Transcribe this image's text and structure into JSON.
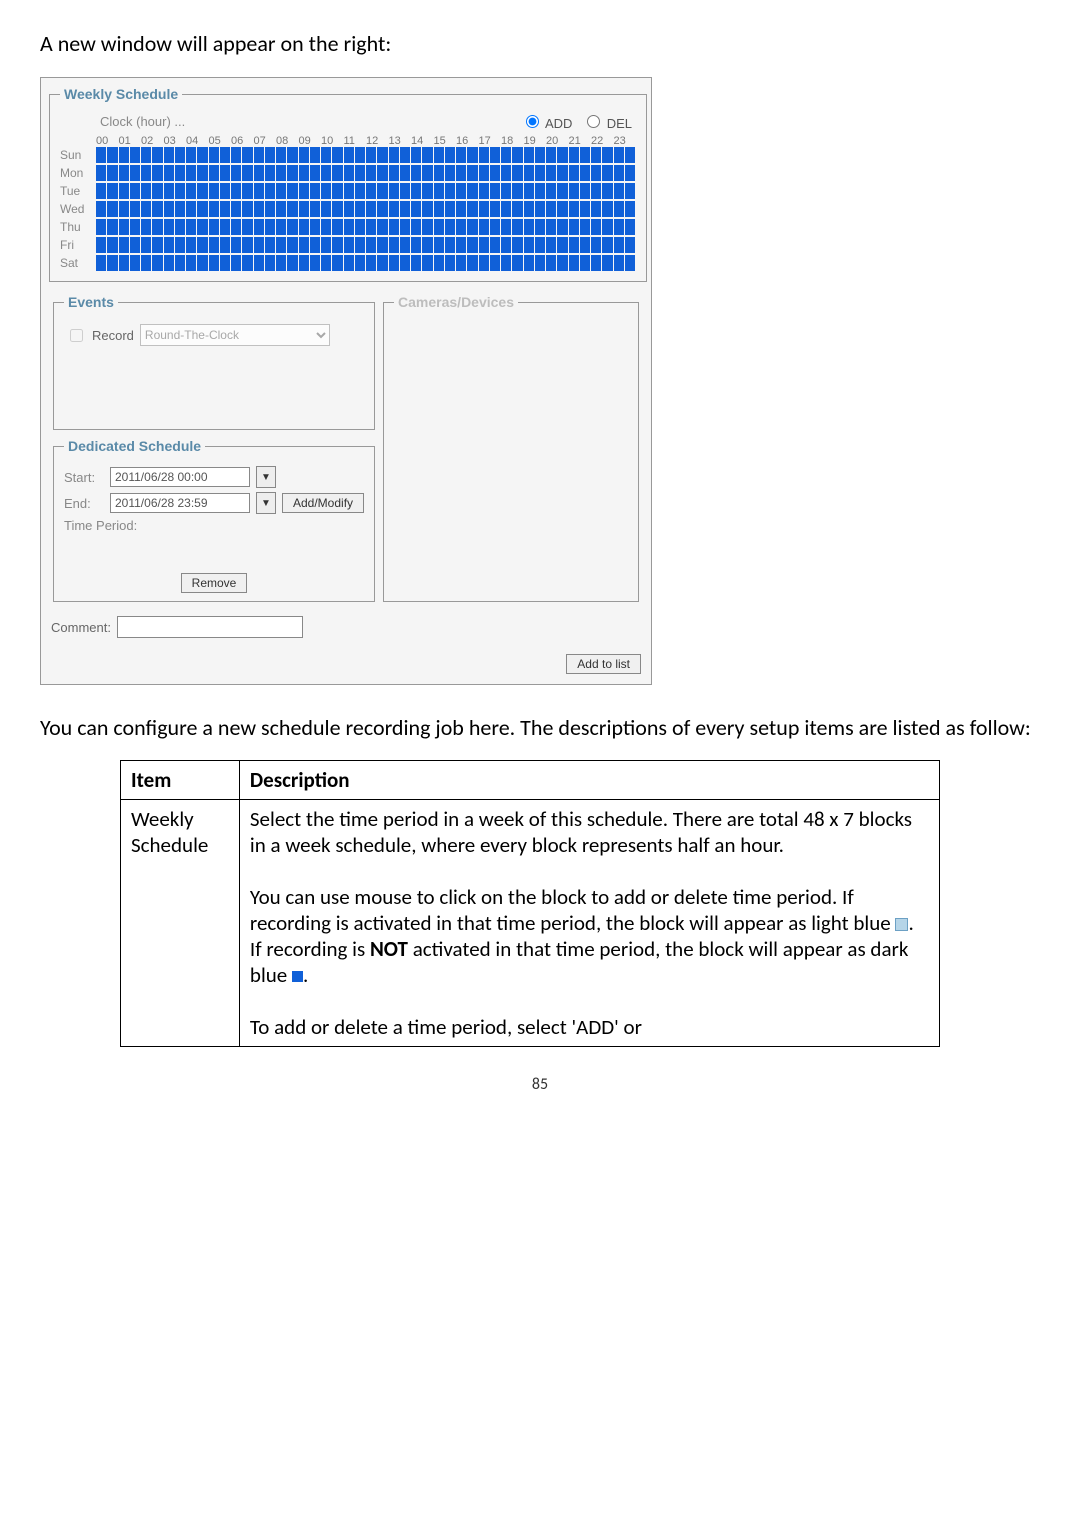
{
  "doc": {
    "intro": "A new window will appear on the right:",
    "para": "You can configure a new schedule recording job here. The descriptions of every setup items are listed as follow:",
    "page_number": "85"
  },
  "win": {
    "weekly_legend": "Weekly Schedule",
    "clock_label": "Clock (hour) ...",
    "add_label": "ADD",
    "del_label": "DEL",
    "hours": [
      "00",
      "01",
      "02",
      "03",
      "04",
      "05",
      "06",
      "07",
      "08",
      "09",
      "10",
      "11",
      "12",
      "13",
      "14",
      "15",
      "16",
      "17",
      "18",
      "19",
      "20",
      "21",
      "22",
      "23"
    ],
    "days": [
      "Sun",
      "Mon",
      "Tue",
      "Wed",
      "Thu",
      "Fri",
      "Sat"
    ],
    "events_legend": "Events",
    "record_label": "Record",
    "record_select": "Round-The-Clock",
    "cameras_legend": "Cameras/Devices",
    "dedicated_legend": "Dedicated Schedule",
    "start_label": "Start:",
    "start_value": "2011/06/28 00:00",
    "end_label": "End:",
    "end_value": "2011/06/28 23:59",
    "addmodify_btn": "Add/Modify",
    "time_period_label": "Time Period:",
    "remove_btn": "Remove",
    "comment_label": "Comment:",
    "addlist_btn": "Add to list"
  },
  "table": {
    "h_item": "Item",
    "h_desc": "Description",
    "r1_item": "Weekly Schedule",
    "r1_p1": "Select the time period in a week of this schedule. There are total 48 x 7 blocks in a week schedule, where every block represents half an hour.",
    "r1_p2a": "You can use mouse to click on the block to add or delete time period. If recording is activated in that time period, the block will appear as light blue ",
    "r1_p2b": ". If recording is ",
    "r1_not": "NOT",
    "r1_p2c": " activated in that time period, the block will appear as dark blue ",
    "r1_p2d": ".",
    "r1_p3": "To add or delete a time period, select 'ADD' or"
  }
}
